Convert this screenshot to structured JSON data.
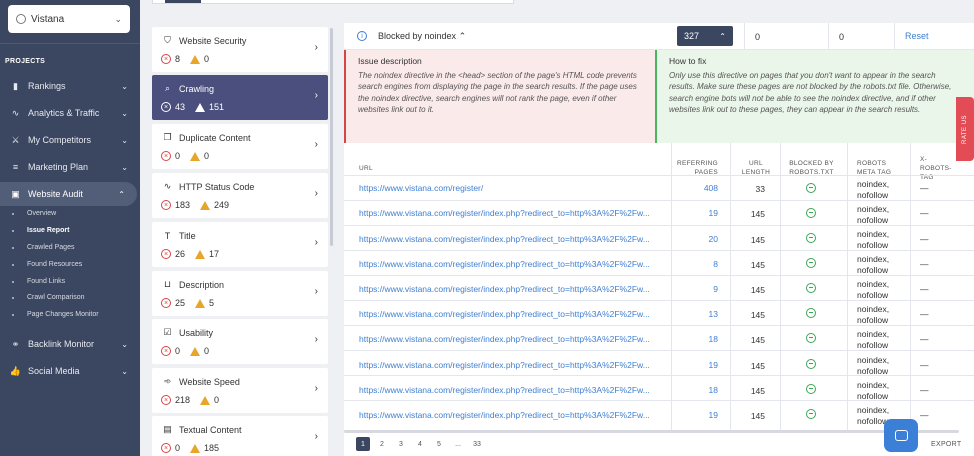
{
  "project": {
    "name": "Vistana"
  },
  "sidebar": {
    "section_title": "PROJECTS",
    "items": [
      {
        "label": "Rankings",
        "icon": "bar-chart-icon"
      },
      {
        "label": "Analytics & Traffic",
        "icon": "analytics-icon"
      },
      {
        "label": "My Competitors",
        "icon": "competitors-icon"
      },
      {
        "label": "Marketing Plan",
        "icon": "marketing-plan-icon"
      },
      {
        "label": "Website Audit",
        "icon": "website-audit-icon"
      },
      {
        "label": "Backlink Monitor",
        "icon": "link-icon"
      },
      {
        "label": "Social Media",
        "icon": "thumbs-up-icon"
      }
    ],
    "audit_subitems": [
      "Overview",
      "Issue Report",
      "Crawled Pages",
      "Found Resources",
      "Found Links",
      "Crawl Comparison",
      "Page Changes Monitor"
    ]
  },
  "issues": [
    {
      "title": "Website Security",
      "errors": "8",
      "warnings": "0",
      "icon": "shield-icon"
    },
    {
      "title": "Crawling",
      "errors": "43",
      "warnings": "151",
      "icon": "search-icon"
    },
    {
      "title": "Duplicate Content",
      "errors": "0",
      "warnings": "0",
      "icon": "duplicate-icon"
    },
    {
      "title": "HTTP Status Code",
      "errors": "183",
      "warnings": "249",
      "icon": "pulse-icon"
    },
    {
      "title": "Title",
      "errors": "26",
      "warnings": "17",
      "icon": "title-icon"
    },
    {
      "title": "Description",
      "errors": "25",
      "warnings": "5",
      "icon": "description-icon"
    },
    {
      "title": "Usability",
      "errors": "0",
      "warnings": "0",
      "icon": "checkbox-icon"
    },
    {
      "title": "Website Speed",
      "errors": "218",
      "warnings": "0",
      "icon": "speed-icon"
    },
    {
      "title": "Textual Content",
      "errors": "0",
      "warnings": "185",
      "icon": "document-icon"
    }
  ],
  "filter": {
    "label": "Blocked by noindex",
    "count": "327",
    "field1": "0",
    "field2": "0",
    "reset_label": "Reset"
  },
  "description": {
    "title": "Issue description",
    "text": "The noindex directive in the <head> section of the page's HTML code prevents search engines from displaying the page in the search results. If the page uses the noindex directive, search engines will not rank the page, even if other websites link out to it."
  },
  "how_to_fix": {
    "title": "How to fix",
    "text": "Only use this directive on pages that you don't want to appear in the search results. Make sure these pages are not blocked by the robots.txt file. Otherwise, search engine bots will not be able to see the noindex directive, and if other websites link out to these pages, they can appear in the search results."
  },
  "table": {
    "headers": {
      "url": "URL",
      "referring_pages": "REFERRING PAGES",
      "url_length": "URL LENGTH",
      "blocked": "BLOCKED BY ROBOTS.TXT",
      "robots_meta": "ROBOTS META TAG",
      "x_robots": "X-ROBOTS-TAG"
    },
    "rows": [
      {
        "url": "https://www.vistana.com/register/",
        "ref": "408",
        "len": "33",
        "meta": "noindex, nofollow",
        "xr": "—"
      },
      {
        "url": "https://www.vistana.com/register/index.php?redirect_to=http%3A%2F%2Fw...",
        "ref": "19",
        "len": "145",
        "meta": "noindex, nofollow",
        "xr": "—"
      },
      {
        "url": "https://www.vistana.com/register/index.php?redirect_to=http%3A%2F%2Fw...",
        "ref": "20",
        "len": "145",
        "meta": "noindex, nofollow",
        "xr": "—"
      },
      {
        "url": "https://www.vistana.com/register/index.php?redirect_to=http%3A%2F%2Fw...",
        "ref": "8",
        "len": "145",
        "meta": "noindex, nofollow",
        "xr": "—"
      },
      {
        "url": "https://www.vistana.com/register/index.php?redirect_to=http%3A%2F%2Fw...",
        "ref": "9",
        "len": "145",
        "meta": "noindex, nofollow",
        "xr": "—"
      },
      {
        "url": "https://www.vistana.com/register/index.php?redirect_to=http%3A%2F%2Fw...",
        "ref": "13",
        "len": "145",
        "meta": "noindex, nofollow",
        "xr": "—"
      },
      {
        "url": "https://www.vistana.com/register/index.php?redirect_to=http%3A%2F%2Fw...",
        "ref": "18",
        "len": "145",
        "meta": "noindex, nofollow",
        "xr": "—"
      },
      {
        "url": "https://www.vistana.com/register/index.php?redirect_to=http%3A%2F%2Fw...",
        "ref": "19",
        "len": "145",
        "meta": "noindex, nofollow",
        "xr": "—"
      },
      {
        "url": "https://www.vistana.com/register/index.php?redirect_to=http%3A%2F%2Fw...",
        "ref": "18",
        "len": "145",
        "meta": "noindex, nofollow",
        "xr": "—"
      },
      {
        "url": "https://www.vistana.com/register/index.php?redirect_to=http%3A%2F%2Fw...",
        "ref": "19",
        "len": "145",
        "meta": "noindex, nofollow",
        "xr": "—"
      }
    ]
  },
  "pagination": {
    "pages": [
      "1",
      "2",
      "3",
      "4",
      "5",
      "...",
      "33"
    ],
    "current": "1"
  },
  "export_label": "EXPORT",
  "rate_label": "RATE US",
  "colors": {
    "sidebar": "#3b4660",
    "active_issue": "#4b4f7d",
    "link": "#3f7fd1",
    "error": "#d64545",
    "warning": "#e7a52a",
    "ok": "#3aa657"
  }
}
